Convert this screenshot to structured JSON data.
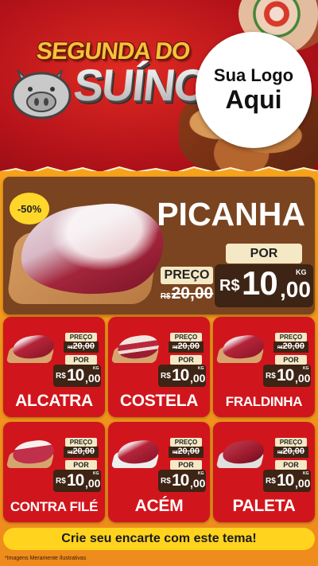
{
  "header": {
    "title_line1": "SEGUNDA DO",
    "title_line2": "SUÍNO",
    "logo_line1": "Sua Logo",
    "logo_line2": "Aqui"
  },
  "hero": {
    "badge": "-50%",
    "name": "PICANHA",
    "preco_label": "PREÇO",
    "old_currency": "R$",
    "old_price": "20,00",
    "por_label": "POR",
    "currency": "R$",
    "price_int": "10",
    "price_dec": ",00",
    "unit": "KG"
  },
  "labels": {
    "preco": "PREÇO",
    "por": "POR",
    "currency": "R$",
    "unit": "KG"
  },
  "products": [
    {
      "name": "ALCATRA",
      "old_price": "20,00",
      "price_int": "10",
      "price_dec": ",00"
    },
    {
      "name": "COSTELA",
      "old_price": "20,00",
      "price_int": "10",
      "price_dec": ",00"
    },
    {
      "name": "FRALDINHA",
      "old_price": "20,00",
      "price_int": "10",
      "price_dec": ",00"
    },
    {
      "name": "CONTRA FILÉ",
      "old_price": "20,00",
      "price_int": "10",
      "price_dec": ",00"
    },
    {
      "name": "ACÉM",
      "old_price": "20,00",
      "price_int": "10",
      "price_dec": ",00"
    },
    {
      "name": "PALETA",
      "old_price": "20,00",
      "price_int": "10",
      "price_dec": ",00"
    }
  ],
  "footer": {
    "cta": "Crie seu encarte com este tema!",
    "note": "*Imagens Meramente Ilustrativas"
  },
  "colors": {
    "red": "#d1151c",
    "orange": "#f39a1b",
    "brown": "#7a4420",
    "dark_price": "#3d2414",
    "cream": "#f5e8c5",
    "yellow": "#ffd31e"
  }
}
